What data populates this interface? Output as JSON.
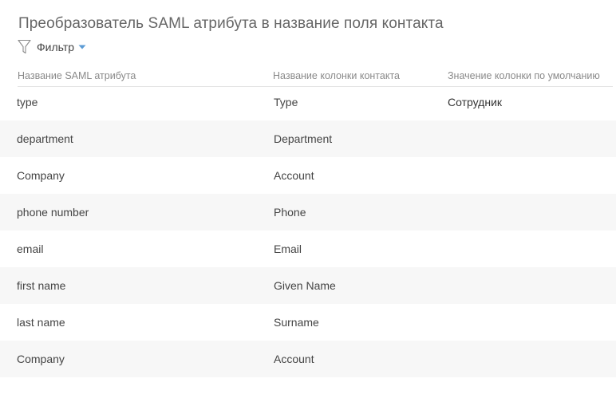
{
  "page": {
    "title": "Преобразователь SAML атрибута в название поля контакта"
  },
  "toolbar": {
    "filter_icon": "filter-funnel-icon",
    "filter_label": "Фильтр",
    "caret_icon": "caret-down-icon",
    "accent_color": "#5b9bd5"
  },
  "grid": {
    "columns": [
      "Название SAML атрибута",
      "Название колонки контакта",
      "Значение колонки по умолчанию"
    ],
    "rows": [
      {
        "saml_attribute": "type",
        "contact_column": "Type",
        "default_value": "Сотрудник"
      },
      {
        "saml_attribute": "department",
        "contact_column": "Department",
        "default_value": ""
      },
      {
        "saml_attribute": "Company",
        "contact_column": "Account",
        "default_value": ""
      },
      {
        "saml_attribute": "phone number",
        "contact_column": "Phone",
        "default_value": ""
      },
      {
        "saml_attribute": "email",
        "contact_column": "Email",
        "default_value": ""
      },
      {
        "saml_attribute": "first name",
        "contact_column": "Given Name",
        "default_value": ""
      },
      {
        "saml_attribute": "last name",
        "contact_column": "Surname",
        "default_value": ""
      },
      {
        "saml_attribute": "Company",
        "contact_column": "Account",
        "default_value": ""
      }
    ]
  }
}
